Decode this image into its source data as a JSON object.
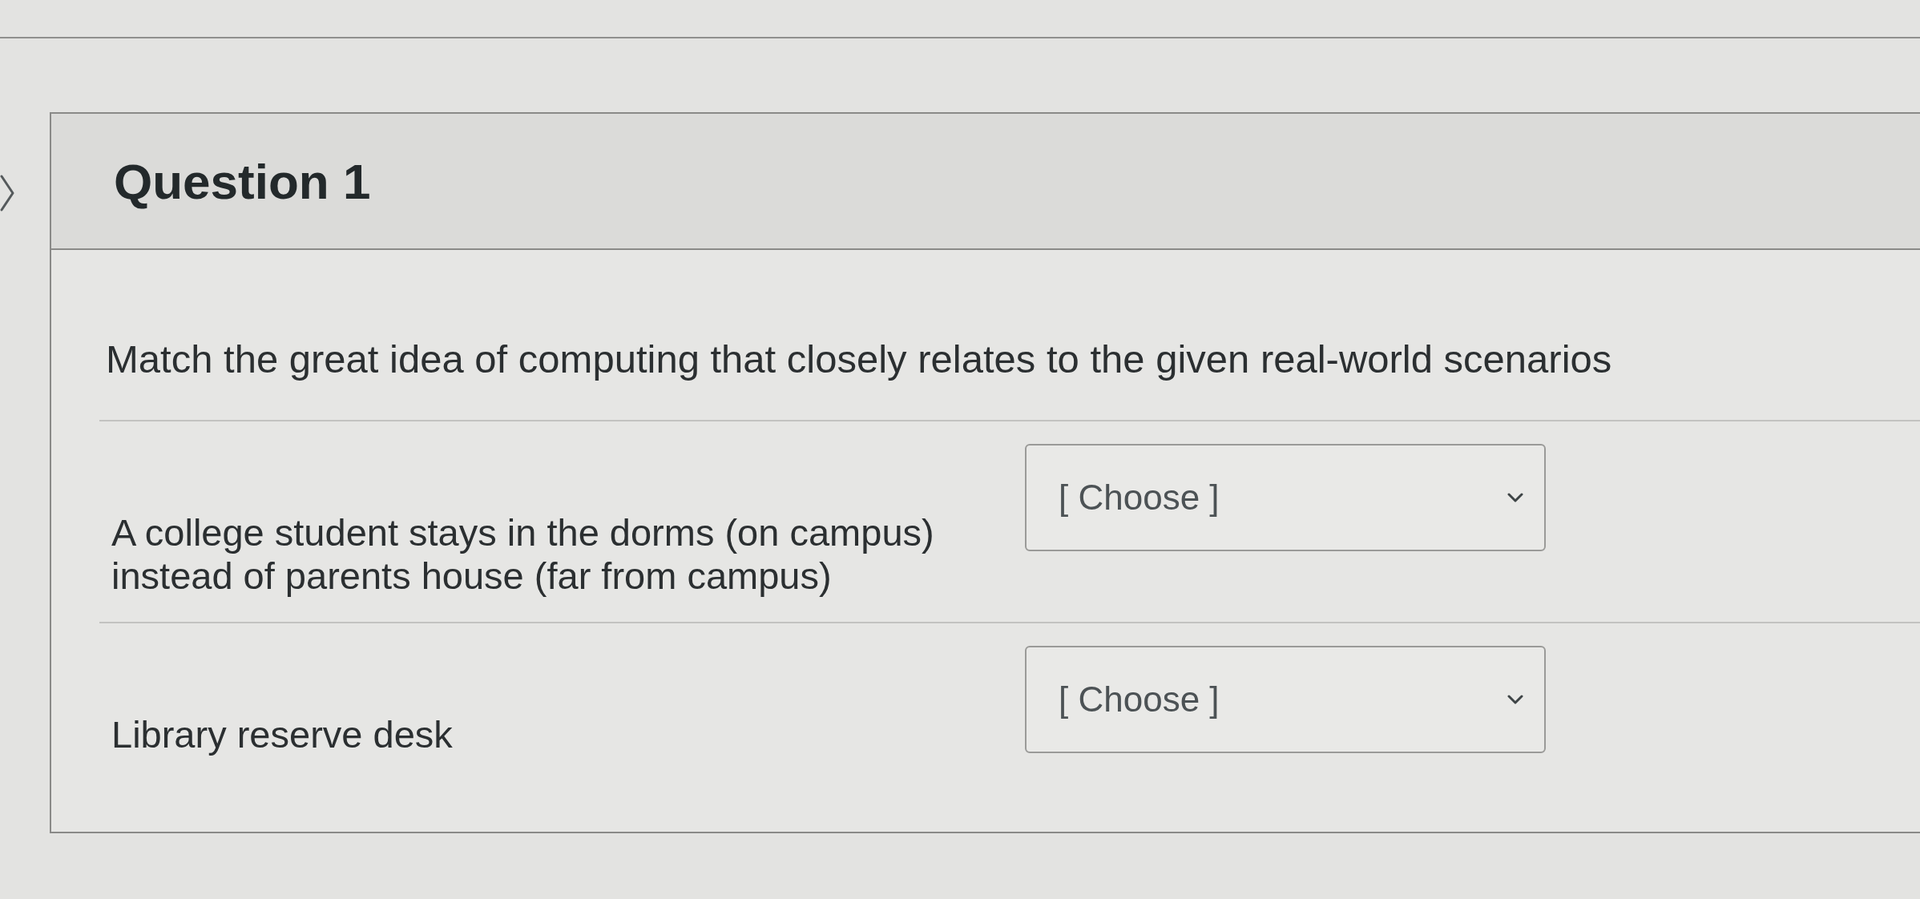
{
  "question": {
    "title": "Question 1",
    "prompt": "Match the great idea of computing that closely relates to the given real-world scenarios",
    "matches": [
      {
        "scenario": "A college student stays in the dorms (on campus) instead of parents house (far from campus)",
        "answer": {
          "value": "[ Choose ]"
        }
      },
      {
        "scenario": "Library reserve desk",
        "answer": {
          "value": "[ Choose ]"
        }
      }
    ]
  }
}
